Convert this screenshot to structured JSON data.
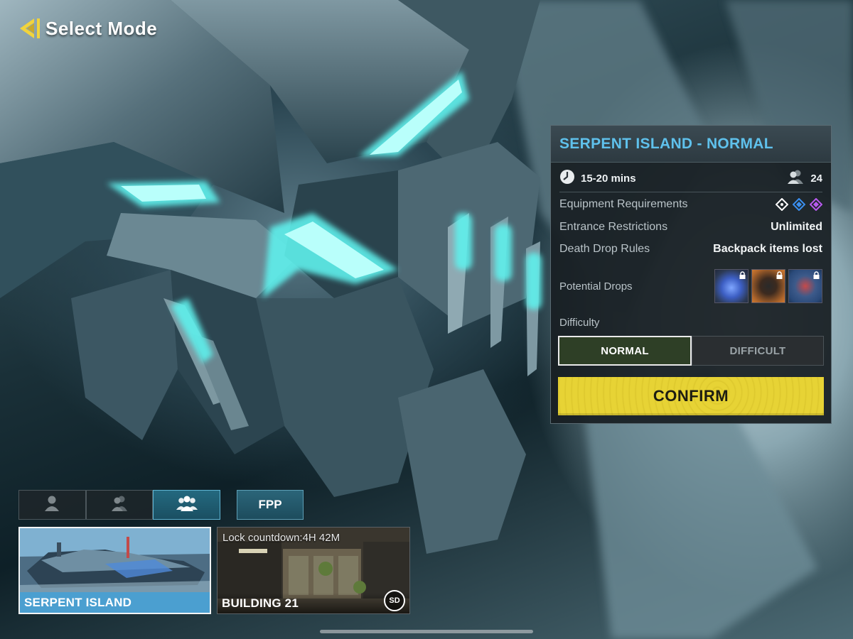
{
  "header": {
    "title": "Select Mode",
    "back_icon": "back-arrow-icon"
  },
  "mode_panel": {
    "title": "SERPENT ISLAND - NORMAL",
    "duration": "15-20 mins",
    "players": "24",
    "rows": {
      "equipment_label": "Equipment Requirements",
      "equipment_icons": [
        "white-diamond-icon",
        "blue-diamond-icon",
        "purple-diamond-icon"
      ],
      "entrance_label": "Entrance Restrictions",
      "entrance_value": "Unlimited",
      "death_label": "Death Drop Rules",
      "death_value": "Backpack items lost",
      "drops_label": "Potential Drops",
      "drops": [
        "blue-skull-item",
        "dark-ring-item",
        "red-blue-case-item"
      ],
      "difficulty_label": "Difficulty"
    },
    "difficulty": {
      "options": [
        "NORMAL",
        "DIFFICULT"
      ],
      "selected": "NORMAL"
    },
    "confirm_label": "CONFIRM"
  },
  "squad_tabs": {
    "options": [
      "solo-icon",
      "duo-icon",
      "squad-icon"
    ],
    "selected": "squad-icon",
    "perspective": "FPP"
  },
  "maps": [
    {
      "name": "SERPENT ISLAND",
      "selected": true
    },
    {
      "name": "BUILDING 21",
      "countdown": "Lock countdown:4H 42M",
      "badge": "SD",
      "selected": false
    }
  ],
  "colors": {
    "accent_blue": "#5fc1ec",
    "confirm_yellow": "#e7d335",
    "selected_tab": "#1a4f62"
  }
}
